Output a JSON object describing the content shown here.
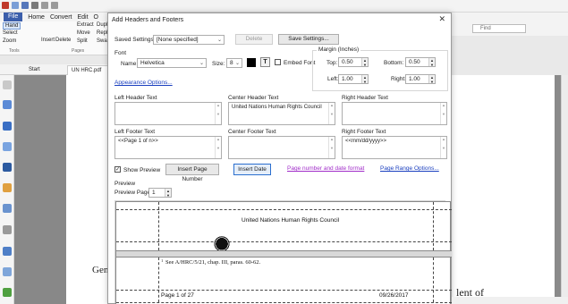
{
  "app": {
    "menu": [
      "File",
      "Home",
      "Convert",
      "Edit",
      "O"
    ],
    "ribbon_items": [
      "Hand",
      "Select",
      "Zoom",
      "Insert",
      "Delete",
      "Extract",
      "Move",
      "Split",
      "Dupl",
      "Repl",
      "Swap"
    ],
    "ribbon_groups": [
      "Tools",
      "Pages"
    ],
    "tabs": {
      "start": "Start",
      "doc": "UN HRC.pdf"
    },
    "find_placeholder": "Find",
    "doc_fragment_left": "Gen",
    "doc_fragment_right": "lent of"
  },
  "dialog": {
    "title": "Add Headers and Footers",
    "saved_settings_label": "Saved Settings:",
    "saved_settings_value": "[None specified]",
    "delete_label": "Delete",
    "save_settings_label": "Save Settings...",
    "font": {
      "group_label": "Font",
      "name_label": "Name:",
      "name_value": "Helvetica",
      "size_label": "Size:",
      "size_value": "8",
      "underline_glyph": "T",
      "embed_label": "Embed Font"
    },
    "margin": {
      "group_label": "Margin (Inches)",
      "top_label": "Top:",
      "top_value": "0.50",
      "bottom_label": "Bottom:",
      "bottom_value": "0.50",
      "left_label": "Left:",
      "left_value": "1.00",
      "right_label": "Right:",
      "right_value": "1.00"
    },
    "appearance_options": "Appearance Options...",
    "headers": {
      "left_label": "Left Header Text",
      "left_value": "",
      "center_label": "Center Header Text",
      "center_value": "United Nations Human Rights Council",
      "right_label": "Right Header Text",
      "right_value": ""
    },
    "footers": {
      "left_label": "Left Footer Text",
      "left_value": "<<Page 1 of n>>",
      "center_label": "Center Footer Text",
      "center_value": "",
      "right_label": "Right Footer Text",
      "right_value": "<<mm/dd/yyyy>>"
    },
    "show_preview_label": "Show Preview",
    "insert_page_number": "Insert Page Number",
    "insert_date": "Insert Date",
    "page_number_date_format": "Page number and date format",
    "page_range_options": "Page Range Options...",
    "preview": {
      "group_label": "Preview",
      "page_label": "Preview Page:",
      "page_value": "1",
      "header_text": "United Nations Human Rights Council",
      "footnote_mark": "1",
      "footnote_text": "See A/HRC/5/21, chap. III, paras. 60-62.",
      "footer_left": "Page 1 of 27",
      "footer_right": "09/26/2017"
    }
  },
  "colors": {
    "accent": "#2b6fcf",
    "link_blue": "#1a3fbf",
    "link_purple": "#a12dc9",
    "file_tab": "#3b5eab"
  }
}
